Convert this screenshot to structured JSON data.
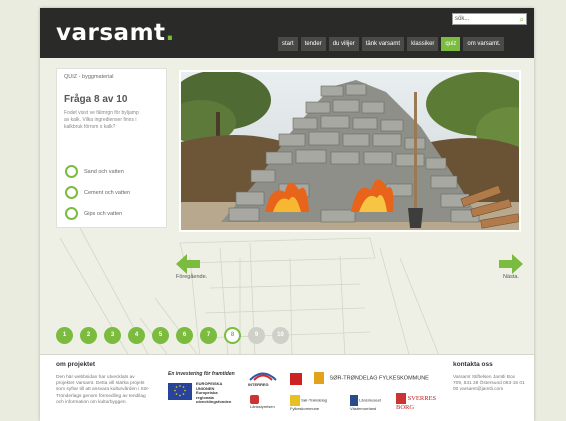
{
  "header": {
    "logo_main": "varsamt",
    "logo_dot": ".",
    "search_placeholder": "sök...",
    "nav": [
      {
        "label": "start",
        "active": false
      },
      {
        "label": "tender",
        "active": false
      },
      {
        "label": "du vilijer",
        "active": false
      },
      {
        "label": "tänk varsamt",
        "active": false
      },
      {
        "label": "klassiker",
        "active": false
      },
      {
        "label": "quiz",
        "active": true
      },
      {
        "label": "om varsamt.",
        "active": false
      }
    ]
  },
  "quiz": {
    "category": "QUIZ - byggmaterial",
    "heading": "Fråga 8 av 10",
    "question": "Fodet visst ve fälmrgn för byljamp av kalk. Vilka ingredienser finns i kalkbruk förrom s kalk?",
    "options": [
      "Sand och vatten",
      "Cement och vatten",
      "Gips och vatten"
    ]
  },
  "nav_arrows": {
    "prev_label": "Föregående.",
    "next_label": "Nästa."
  },
  "progress": {
    "steps": [
      "1",
      "2",
      "3",
      "4",
      "5",
      "6",
      "7",
      "8",
      "9",
      "10"
    ],
    "current": 8
  },
  "footer": {
    "about_title": "om projektet",
    "about_text": "Den här webbsidan har utvecklats av projektet Varsamt. Detta vill stärka projekt som syftar till att ansvara kulturvården i Sör-Trönderlags genom förmedling av tendilag och information om kulturbyggen.",
    "invest_title": "En investering för framtiden",
    "eu_text": "EUROPEISKA UNIONEN Europeiska regionala utvecklingsfonden",
    "logos": [
      "INTERREG",
      "Länsstyrelsen",
      "SØR-TRØNDELAG FYLKESKOMMUNE",
      "Sør-Trøndelag Fylkeskommune",
      "Länsmuseet Västernorrland",
      "SVERRES BORG"
    ],
    "contact_title": "kontakta oss",
    "contact_text": "Varsamt Stiftelsen Jamtli Box 709, 831 28 Östersund 063-15 01 00 varsamt@jamtli.com"
  },
  "colors": {
    "accent": "#7bbb3f",
    "header_bg": "#2a2a28"
  }
}
